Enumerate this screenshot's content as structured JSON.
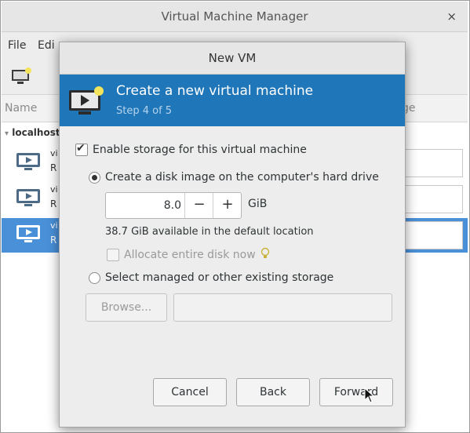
{
  "background_window": {
    "title": "Virtual Machine Manager",
    "close_symbol": "×",
    "menu": [
      "File",
      "Edi"
    ],
    "column_headers": {
      "name": "Name",
      "usage": "ge"
    },
    "connection": "localhost",
    "vms": [
      {
        "name": "vi",
        "status": "R",
        "selected": false
      },
      {
        "name": "vi",
        "status": "R",
        "selected": false
      },
      {
        "name": "vi",
        "status": "R",
        "selected": true
      }
    ]
  },
  "dialog": {
    "title": "New VM",
    "header_title": "Create a new virtual machine",
    "step": "Step 4 of 5",
    "enable_storage": {
      "label": "Enable storage for this virtual machine",
      "checked": true
    },
    "create_disk": {
      "label": "Create a disk image on the computer's hard drive",
      "selected": true
    },
    "disk_size": {
      "value": "8.0",
      "unit": "GiB",
      "minus": "−",
      "plus": "+"
    },
    "available": "38.7 GiB available in the default location",
    "allocate_entire": {
      "label": "Allocate entire disk now",
      "checked": false
    },
    "select_existing": {
      "label": "Select managed or other existing storage",
      "selected": false
    },
    "browse_label": "Browse...",
    "storage_path": "",
    "buttons": {
      "cancel": "Cancel",
      "back": "Back",
      "forward": "Forward"
    }
  },
  "colors": {
    "banner": "#1f76b8",
    "selection": "#4a90d9"
  },
  "icons": [
    "monitor-icon",
    "lightbulb-icon",
    "mouse-cursor-icon"
  ]
}
